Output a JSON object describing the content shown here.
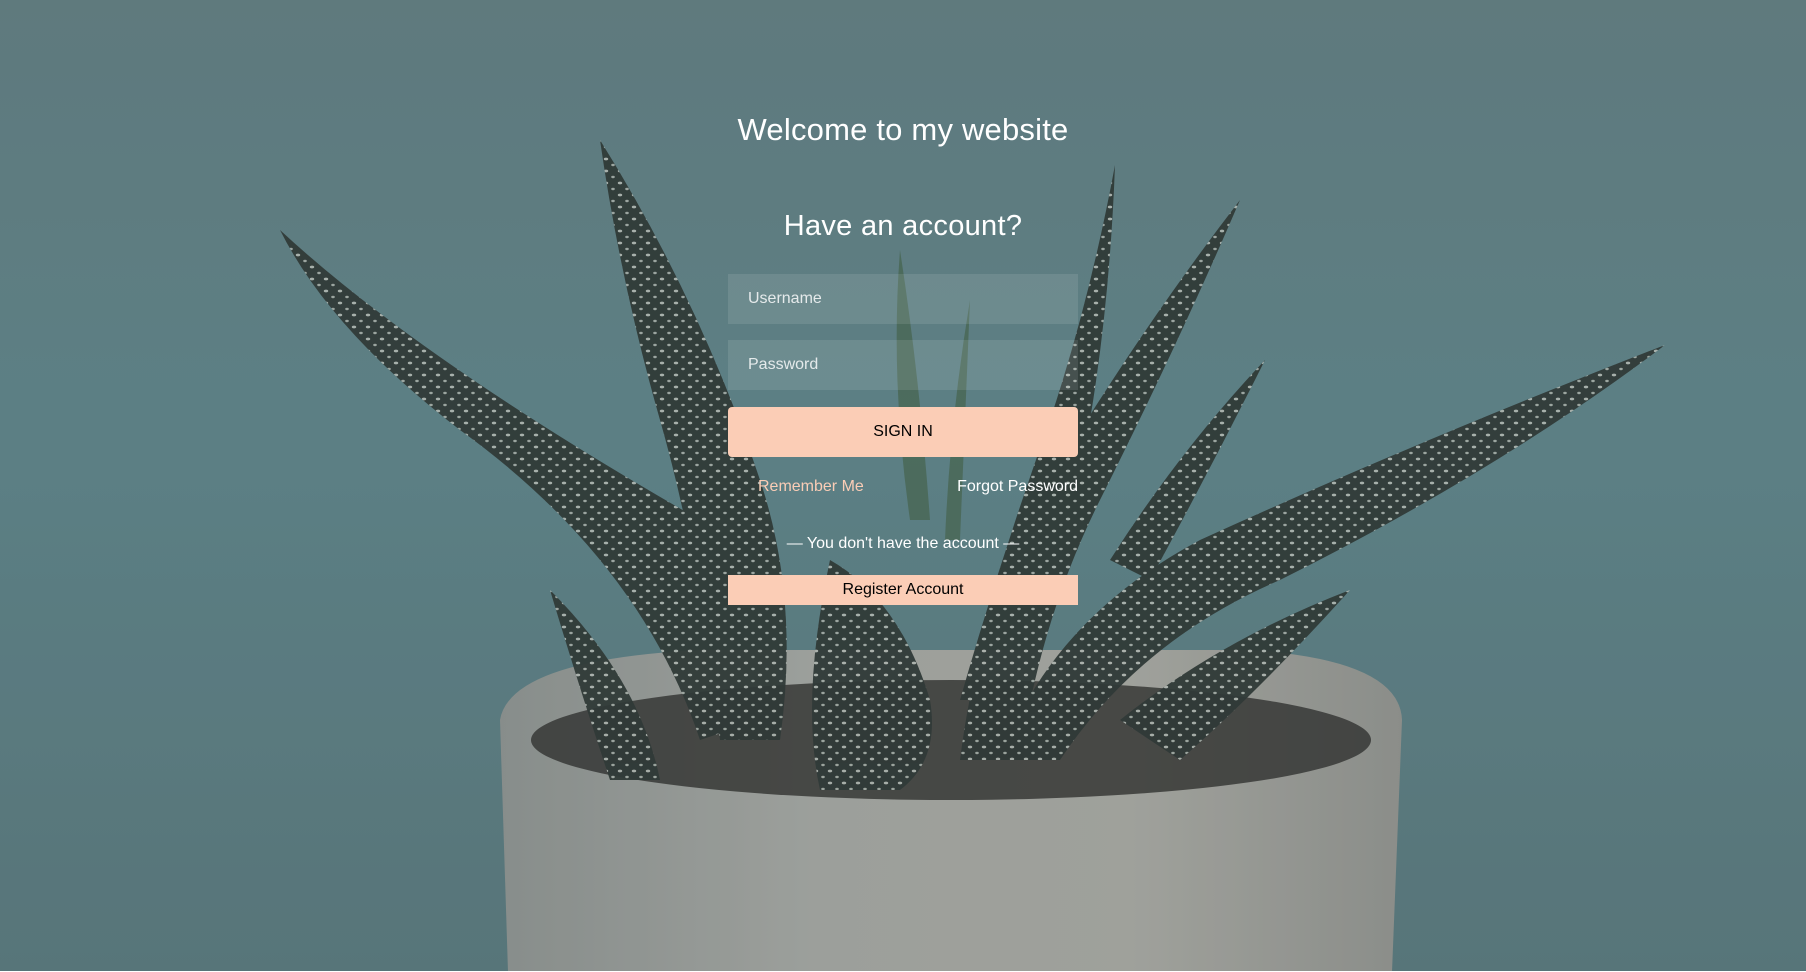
{
  "header": {
    "title": "Welcome to my website"
  },
  "login": {
    "heading": "Have an account?",
    "username": {
      "placeholder": "Username",
      "value": ""
    },
    "password": {
      "placeholder": "Password",
      "value": ""
    },
    "signin_label": "SIGN IN",
    "remember_label": "Remember Me",
    "forgot_label": "Forgot Password",
    "no_account_text": "— You don't have the account —",
    "register_label": "Register Account"
  },
  "colors": {
    "accent": "#fbcdb6",
    "text": "#ffffff",
    "overlay_bg": "#6c8a8e"
  },
  "background": {
    "subject": "potted-succulent-photo"
  }
}
